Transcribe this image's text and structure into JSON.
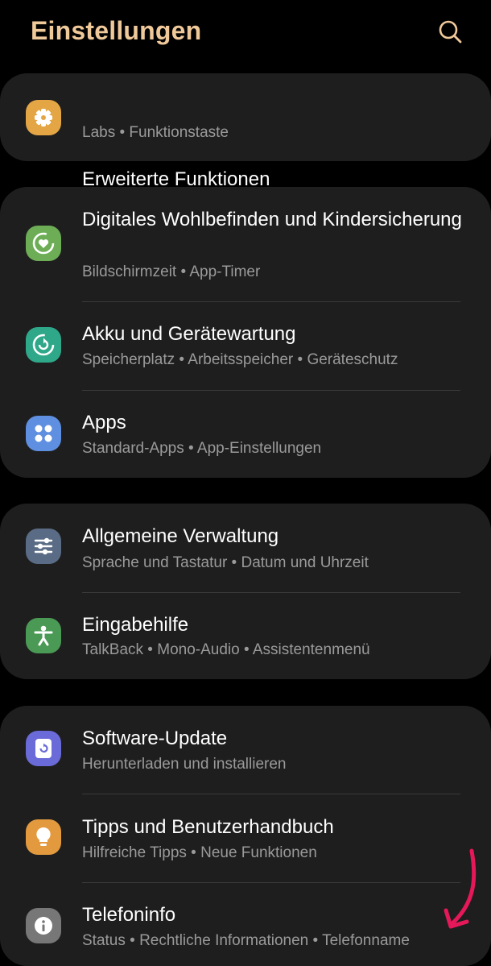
{
  "header": {
    "title": "Einstellungen",
    "search_icon": "search-icon"
  },
  "accent_colors": {
    "title": "#f0c99a",
    "card_bg": "#1e1e1e",
    "annotation_arrow": "#e5185a"
  },
  "groups": [
    {
      "items": [
        {
          "label": "Erweiterte Funktionen",
          "subtitle": "Labs  •  Funktionstaste",
          "icon": "puzzle-gear-icon",
          "icon_color": "#e4a645"
        }
      ]
    },
    {
      "items": [
        {
          "label": "Digitales Wohlbefinden und Kindersicherung",
          "subtitle": "Bildschirmzeit  •  App-Timer",
          "icon": "heart-circle-icon",
          "icon_color": "#6cad55"
        },
        {
          "label": "Akku und Gerätewartung",
          "subtitle": "Speicherplatz  •  Arbeitsspeicher  •  Geräteschutz",
          "icon": "refresh-circle-icon",
          "icon_color": "#2fa88a"
        },
        {
          "label": "Apps",
          "subtitle": "Standard-Apps  •  App-Einstellungen",
          "icon": "apps-grid-icon",
          "icon_color": "#5f8fe0"
        }
      ]
    },
    {
      "items": [
        {
          "label": "Allgemeine Verwaltung",
          "subtitle": "Sprache und Tastatur  •  Datum und Uhrzeit",
          "icon": "sliders-icon",
          "icon_color": "#5a6c85"
        },
        {
          "label": "Eingabehilfe",
          "subtitle": "TalkBack  •  Mono-Audio  •  Assistentenmenü",
          "icon": "accessibility-icon",
          "icon_color": "#4a9a55"
        }
      ]
    },
    {
      "items": [
        {
          "label": "Software-Update",
          "subtitle": "Herunterladen und installieren",
          "icon": "update-icon",
          "icon_color": "#6a6ad8"
        },
        {
          "label": "Tipps und Benutzerhandbuch",
          "subtitle": "Hilfreiche Tipps  •  Neue Funktionen",
          "icon": "lightbulb-icon",
          "icon_color": "#e39a3e"
        },
        {
          "label": "Telefoninfo",
          "subtitle": "Status  •  Rechtliche Informationen  •  Telefonname",
          "icon": "info-icon",
          "icon_color": "#777777"
        }
      ]
    }
  ]
}
